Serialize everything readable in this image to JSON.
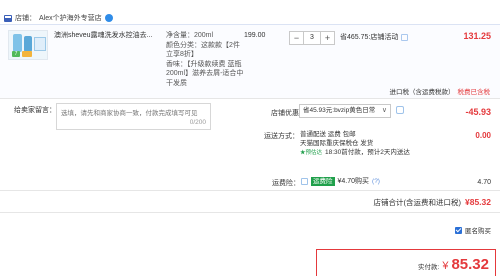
{
  "store": {
    "label": "店铺：",
    "name": "Alex个护海外专营店"
  },
  "item": {
    "title": "澳洲sheveu露魂洗发水控油去...",
    "specs": [
      "净含量：200ml",
      "颜色分类：这款款【2件立享8折】",
      "香味：【升级款续费 蓝瓶200ml】滋养去屑-适合中干发质"
    ],
    "unit_price": "199.00",
    "quantity": "3",
    "promo": "省465.75:店铺活动",
    "total": "131.25"
  },
  "tax": {
    "label": "进口税（含运费税款）",
    "link": "税费已含税"
  },
  "message": {
    "label": "给卖家留言：",
    "placeholder": "选填，请先和商家协商一致，付款完成填写可见",
    "count": "0/200"
  },
  "coupon": {
    "label": "店铺优惠：",
    "selected": "省45.93元:bvzip黄色日常",
    "amount": "-45.93"
  },
  "shipping": {
    "label": "运送方式：",
    "line1": "普通配送 运费 包邮",
    "line2": "天猫国际重庆保税仓 发货",
    "badge": "★预估达",
    "line3": "18:30前付款，预计2天内送达",
    "fee": "0.00"
  },
  "insurance": {
    "label": "运费险：",
    "name": "运费险",
    "price": "¥4.70购买",
    "qa": "(?)",
    "fee": "4.70"
  },
  "store_total": {
    "label": "店铺合计(含运费和进口税)",
    "amount": "¥85.32"
  },
  "anonymous": {
    "label": "匿名购买"
  },
  "payment": {
    "label": "实付款:",
    "yen": "¥",
    "amount": "85.32"
  },
  "colors": {
    "accent": "#e4393c",
    "link": "#2a6fd6",
    "green": "#20a04b"
  }
}
